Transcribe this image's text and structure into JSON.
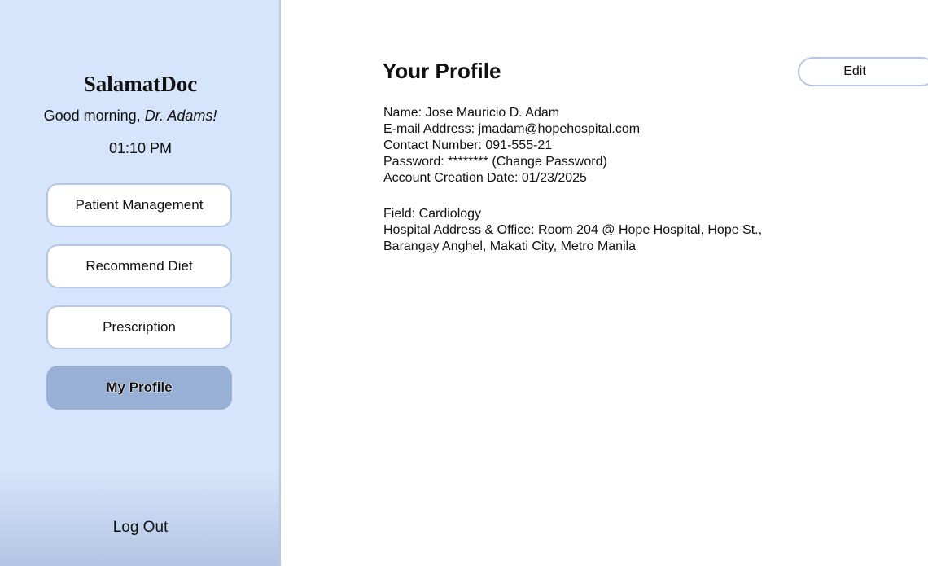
{
  "sidebar": {
    "brand": "SalamatDoc",
    "greeting_prefix": "Good morning, ",
    "greeting_name": "Dr. Adams!",
    "time": "01:10 PM",
    "nav": [
      {
        "label": "Patient Management"
      },
      {
        "label": "Recommend Diet"
      },
      {
        "label": "Prescription"
      },
      {
        "label": "My Profile",
        "active": true
      }
    ],
    "logout_label": "Log Out"
  },
  "main": {
    "title": "Your Profile",
    "edit_label": "Edit",
    "profile": {
      "name": "Name: Jose Mauricio D. Adam",
      "email": "E-mail Address: jmadam@hopehospital.com",
      "contact": "Contact Number: 091-555-21",
      "password_prefix": "Password: ******** ",
      "password_link": "(Change Password)",
      "creation_date": "Account Creation Date: 01/23/2025",
      "field": "Field: Cardiology",
      "hospital_line1": "Hospital Address & Office: Room 204 @ Hope Hospital, Hope St.,",
      "hospital_line2": "Barangay Anghel, Makati City, Metro Manila"
    }
  },
  "colors": {
    "sidebar_bg": "#d6e5fb",
    "active_nav": "#99b0d6",
    "border": "#b7c6e4"
  }
}
